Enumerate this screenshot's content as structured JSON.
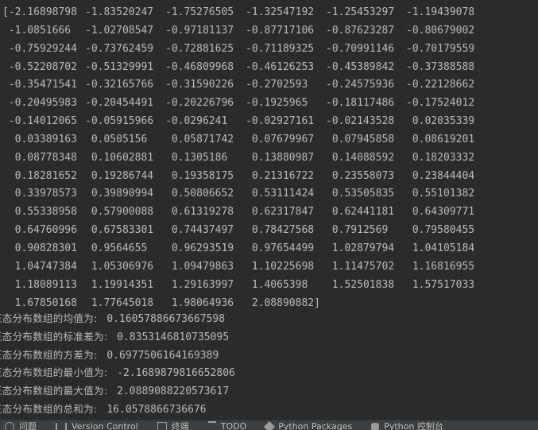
{
  "console": {
    "array_rows": [
      [
        "[-2.16898798",
        "-1.83520247",
        "-1.75276505",
        "-1.32547192",
        "-1.25453297",
        "-1.19439078"
      ],
      [
        " -1.0851666 ",
        "-1.02708547",
        "-0.97181137",
        "-0.87717106",
        "-0.87623287",
        "-0.80679002"
      ],
      [
        " -0.75929244",
        "-0.73762459",
        "-0.72881625",
        "-0.71189325",
        "-0.70991146",
        "-0.70179559"
      ],
      [
        " -0.52208702",
        "-0.51329991",
        "-0.46809968",
        "-0.46126253",
        "-0.45389842",
        "-0.37388588"
      ],
      [
        " -0.35471541",
        "-0.32165766",
        "-0.31590226",
        "-0.2702593 ",
        "-0.24575936",
        "-0.22128662"
      ],
      [
        " -0.20495983",
        "-0.20454491",
        "-0.20226796",
        "-0.1925965 ",
        "-0.18117486",
        "-0.17524012"
      ],
      [
        " -0.14012065",
        "-0.05915966",
        "-0.0296241 ",
        "-0.02927161",
        "-0.02143528",
        " 0.02035339"
      ],
      [
        "  0.03389163",
        " 0.0505156 ",
        " 0.05871742",
        " 0.07679967",
        " 0.07945858",
        " 0.08619201"
      ],
      [
        "  0.08778348",
        " 0.10602881",
        " 0.1305186 ",
        " 0.13880987",
        " 0.14088592",
        " 0.18203332"
      ],
      [
        "  0.18281652",
        " 0.19286744",
        " 0.19358175",
        " 0.21316722",
        " 0.23558073",
        " 0.23844404"
      ],
      [
        "  0.33978573",
        " 0.39890994",
        " 0.50806652",
        " 0.53111424",
        " 0.53505835",
        " 0.55101382"
      ],
      [
        "  0.55338958",
        " 0.57900088",
        " 0.61319278",
        " 0.62317847",
        " 0.62441181",
        " 0.64309771"
      ],
      [
        "  0.64760996",
        " 0.67583301",
        " 0.74437497",
        " 0.78427568",
        " 0.7912569 ",
        " 0.79580455"
      ],
      [
        "  0.90828301",
        " 0.9564655 ",
        " 0.96293519",
        " 0.97654499",
        " 1.02879794",
        " 1.04105184"
      ],
      [
        "  1.04747384",
        " 1.05306976",
        " 1.09479863",
        " 1.10225698",
        " 1.11475702",
        " 1.16816955"
      ],
      [
        "  1.18089113",
        " 1.19914351",
        " 1.29163997",
        " 1.4065398 ",
        " 1.52501838",
        " 1.57517033"
      ],
      [
        "  1.67850168",
        " 1.77645018",
        " 1.98064936",
        " 2.08890882]"
      ]
    ],
    "stats": [
      {
        "label": "正态分布数组的均值为:",
        "value": "0.16057886673667598"
      },
      {
        "label": "正态分布数组的标准差为:",
        "value": "0.8353146810735095"
      },
      {
        "label": "正态分布数组的方差为:",
        "value": "0.6977506164169389"
      },
      {
        "label": "正态分布数组的最小值为:",
        "value": "-2.1689879816652806"
      },
      {
        "label": "正态分布数组的最大值为:",
        "value": "2.0889088220573617"
      },
      {
        "label": "正态分布数组的总和为:",
        "value": "16.0578866736676"
      }
    ]
  },
  "statusbar": {
    "tabs": [
      {
        "label": "问题",
        "icon": "problems-icon"
      },
      {
        "label": "Version Control",
        "icon": "version-control-icon"
      },
      {
        "label": "终端",
        "icon": "terminal-icon"
      },
      {
        "label": "TODO",
        "icon": "todo-icon"
      },
      {
        "label": "Python Packages",
        "icon": "python-packages-icon"
      },
      {
        "label": "Python 控制台",
        "icon": "python-console-icon"
      }
    ]
  }
}
